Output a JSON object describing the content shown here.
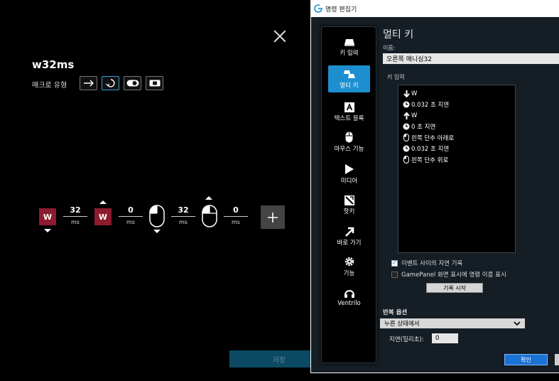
{
  "macro": {
    "title": "w32ms",
    "type_label": "매크로 유형",
    "sequence": {
      "key1": "W",
      "delay1": "32",
      "key2": "W",
      "delay2": "0",
      "delay3": "32",
      "delay4": "0",
      "unit": "ms"
    },
    "save_label": "저장"
  },
  "dialog": {
    "window_title": "명령 편집기",
    "heading": "멀티 키",
    "name_label": "이름:",
    "name_value": "오른쪽 매니싱32",
    "keyin_label": "키 입력",
    "categories": [
      {
        "label": "키 입력",
        "icon": "key-icon"
      },
      {
        "label": "멀티 키",
        "icon": "multikey-icon"
      },
      {
        "label": "텍스트 블록",
        "icon": "text-block-icon"
      },
      {
        "label": "마우스 기능",
        "icon": "mouse-icon"
      },
      {
        "label": "미디어",
        "icon": "play-icon"
      },
      {
        "label": "핫키",
        "icon": "hotkey-icon"
      },
      {
        "label": "바로 가기",
        "icon": "shortcut-arrow-icon"
      },
      {
        "label": "기능",
        "icon": "gear-icon"
      },
      {
        "label": "Ventrilo",
        "icon": "headset-icon"
      }
    ],
    "events": [
      {
        "icon": "arrow-down-icon",
        "text": "W"
      },
      {
        "icon": "clock-icon",
        "text": "0.032 초 지연"
      },
      {
        "icon": "arrow-up-icon",
        "text": "W"
      },
      {
        "icon": "clock-icon",
        "text": "0 초 지연"
      },
      {
        "icon": "mouse-icon",
        "text": "왼쪽 단추 아래로"
      },
      {
        "icon": "clock-icon",
        "text": "0.032 초 지연"
      },
      {
        "icon": "mouse-icon",
        "text": "왼쪽 단추 위로"
      }
    ],
    "record_delays_label": "이벤트 사이의 지연 기록",
    "gamepanel_label": "GamePanel 화면 표시에 명령 이름 표시",
    "record_button": "기록 시작",
    "repeat_label": "반복 옵션",
    "repeat_value": "누른 상태에서",
    "delay_label": "지연(밀리초):",
    "delay_value": "0",
    "ok_label": "확인"
  },
  "colors": {
    "key_tile": "#8c1b2e",
    "accent": "#1d8fd1",
    "save": "#0c4a63"
  }
}
